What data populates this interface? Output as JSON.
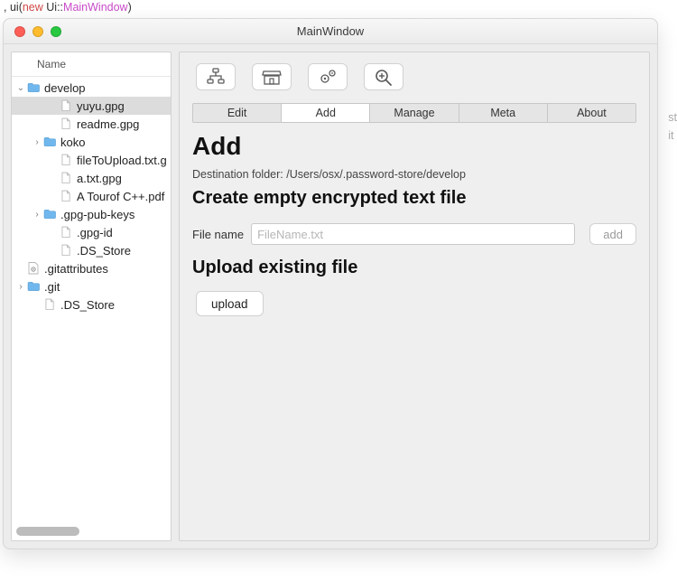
{
  "code_line": {
    "pre": ", ",
    "fn": "ui",
    "paren_open": "(",
    "kw_new": "new ",
    "ns": "Ui",
    "scope": "::",
    "cls": "MainWindow",
    "paren_close": ")"
  },
  "window": {
    "title": "MainWindow"
  },
  "tree": {
    "header": "Name",
    "items": [
      {
        "depth": 0,
        "arrow": "down",
        "icon": "folder",
        "label": "develop",
        "selected": false
      },
      {
        "depth": 2,
        "arrow": "",
        "icon": "file",
        "label": "yuyu.gpg",
        "selected": true
      },
      {
        "depth": 2,
        "arrow": "",
        "icon": "file",
        "label": "readme.gpg",
        "selected": false
      },
      {
        "depth": 1,
        "arrow": "right",
        "icon": "folder",
        "label": "koko",
        "selected": false
      },
      {
        "depth": 2,
        "arrow": "",
        "icon": "file",
        "label": "fileToUpload.txt.g",
        "selected": false
      },
      {
        "depth": 2,
        "arrow": "",
        "icon": "file",
        "label": "a.txt.gpg",
        "selected": false
      },
      {
        "depth": 2,
        "arrow": "",
        "icon": "file",
        "label": "A Tourof C++.pdf",
        "selected": false
      },
      {
        "depth": 1,
        "arrow": "right",
        "icon": "folder",
        "label": ".gpg-pub-keys",
        "selected": false
      },
      {
        "depth": 2,
        "arrow": "",
        "icon": "file",
        "label": ".gpg-id",
        "selected": false
      },
      {
        "depth": 2,
        "arrow": "",
        "icon": "file",
        "label": ".DS_Store",
        "selected": false
      },
      {
        "depth": 0,
        "arrow": "",
        "icon": "gear",
        "label": ".gitattributes",
        "selected": false
      },
      {
        "depth": 0,
        "arrow": "right",
        "icon": "folder",
        "label": ".git",
        "selected": false
      },
      {
        "depth": 1,
        "arrow": "",
        "icon": "file",
        "label": ".DS_Store",
        "selected": false
      }
    ]
  },
  "toolbar_icons": [
    "tree-icon",
    "shop-icon",
    "gears-icon",
    "zoom-icon"
  ],
  "tabs": [
    {
      "label": "Edit",
      "active": false
    },
    {
      "label": "Add",
      "active": true
    },
    {
      "label": "Manage",
      "active": false
    },
    {
      "label": "Meta",
      "active": false
    },
    {
      "label": "About",
      "active": false
    }
  ],
  "page": {
    "heading": "Add",
    "destination_line": "Destination folder: /Users/osx/.password-store/develop",
    "create_heading": "Create empty encrypted text file",
    "filename_label": "File name",
    "filename_placeholder": "FileName.txt",
    "add_button": "add",
    "upload_heading": "Upload existing file",
    "upload_button": "upload"
  },
  "ghost": {
    "l1": "st",
    "l2": "it"
  }
}
